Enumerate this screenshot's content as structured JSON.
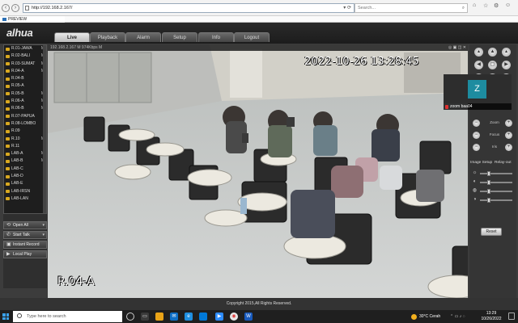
{
  "browser": {
    "url": "http://192.168.2.167/",
    "search_placeholder": "Search...",
    "tab_title": "PREVIEW"
  },
  "app": {
    "logo": "alhua",
    "menu": [
      "Live",
      "Playback",
      "Alarm",
      "Setup",
      "Info",
      "Logout"
    ],
    "active_menu": "Live"
  },
  "channels": [
    {
      "name": "R.01-JAWA",
      "flag": "M"
    },
    {
      "name": "R.02-BALI",
      "flag": "M"
    },
    {
      "name": "R.03-SUMAT",
      "flag": "M"
    },
    {
      "name": "R.04-A",
      "flag": "M"
    },
    {
      "name": "R.04-B",
      "flag": ""
    },
    {
      "name": "R.05-A",
      "flag": ""
    },
    {
      "name": "R.05-B",
      "flag": "M"
    },
    {
      "name": "R.06-A",
      "flag": "M"
    },
    {
      "name": "R.06-B",
      "flag": "M"
    },
    {
      "name": "R.07-PAPUA",
      "flag": ""
    },
    {
      "name": "R.08-LOMBO",
      "flag": ""
    },
    {
      "name": "R.09",
      "flag": ""
    },
    {
      "name": "R.10",
      "flag": "M"
    },
    {
      "name": "R.11",
      "flag": ""
    },
    {
      "name": "LAB-A",
      "flag": "M"
    },
    {
      "name": "LAB-B",
      "flag": "M"
    },
    {
      "name": "LAB-C",
      "flag": ""
    },
    {
      "name": "LAB-D",
      "flag": ""
    },
    {
      "name": "LAB-E",
      "flag": ""
    },
    {
      "name": "LAB-IRSN",
      "flag": ""
    },
    {
      "name": "LAB-LAN",
      "flag": ""
    }
  ],
  "side_buttons": {
    "open_all": "Open All",
    "start_talk": "Start Talk",
    "instant_record": "Instant Record",
    "local_play": "Local Play"
  },
  "video": {
    "info": "192.168.2.167 M 974Kbps M",
    "timestamp": "2022-10-26 13:28:45",
    "camera_label": "R.04-A"
  },
  "ptz": {
    "zoom_label": "Zoom",
    "focus_label": "Focus",
    "iris_label": "Iris"
  },
  "image_setup": {
    "title": "Image Setup",
    "relay_out": "Relay-out",
    "reset": "Reset",
    "levels": [
      0.25,
      0.25,
      0.25,
      0.25
    ]
  },
  "zoom_overlay": {
    "avatar_letter": "Z",
    "name": "zoom baa04"
  },
  "footer": "Copyright 2015,All Rights Reserved.",
  "taskbar": {
    "search_placeholder": "Type here to search",
    "weather": "30°C  Cerah",
    "time": "13:29",
    "date": "10/26/2022"
  }
}
